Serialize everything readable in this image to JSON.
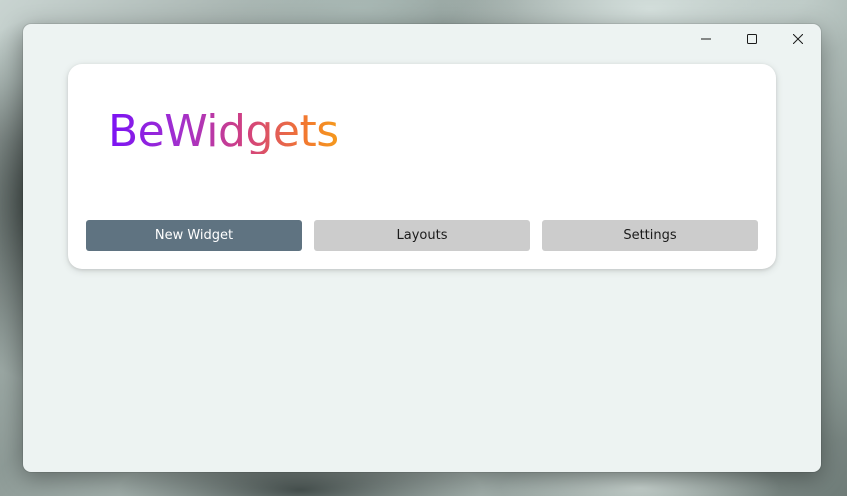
{
  "app": {
    "name": "BeWidgets"
  },
  "window_controls": {
    "minimize": "minimize-icon",
    "maximize": "maximize-icon",
    "close": "close-icon"
  },
  "actions": {
    "new_widget_label": "New Widget",
    "layouts_label": "Layouts",
    "settings_label": "Settings"
  },
  "colors": {
    "primary_button": "#5f7381",
    "secondary_button": "#cccccc",
    "logo_gradient_start": "#7a12f5",
    "logo_gradient_end": "#f59a1c"
  }
}
